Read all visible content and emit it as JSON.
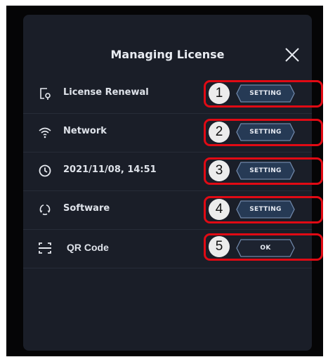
{
  "dialog": {
    "title": "Managing License",
    "close_icon": "close-icon"
  },
  "rows": [
    {
      "label": "License Renewal",
      "icon": "license-renewal-icon",
      "button": "SETTING",
      "marker": "1"
    },
    {
      "label": "Network",
      "icon": "wifi-icon",
      "button": "SETTING",
      "marker": "2"
    },
    {
      "label": "2021/11/08, 14:51",
      "icon": "clock-icon",
      "button": "SETTING",
      "marker": "3"
    },
    {
      "label": "Software",
      "icon": "refresh-icon",
      "button": "SETTING",
      "marker": "4"
    },
    {
      "label": "QR Code",
      "icon": "qr-scan-icon",
      "button": "OK",
      "marker": "5"
    }
  ],
  "colors": {
    "panel_background": "#1a1e28",
    "callout_red": "#e00a14",
    "button_fill": "#263a55",
    "button_border": "#6f86a8"
  }
}
